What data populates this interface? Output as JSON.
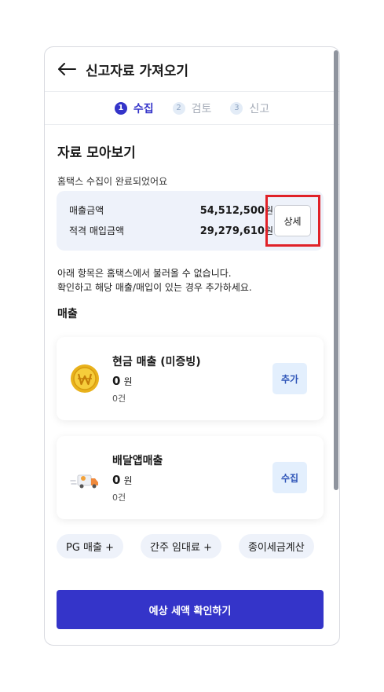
{
  "header": {
    "title": "신고자료 가져오기"
  },
  "stepper": {
    "steps": [
      {
        "num": "1",
        "label": "수집"
      },
      {
        "num": "2",
        "label": "검토"
      },
      {
        "num": "3",
        "label": "신고"
      }
    ]
  },
  "summary": {
    "section_title": "자료 모아보기",
    "status_text": "홈택스 수집이 완료되었어요",
    "rows": [
      {
        "label": "매출금액",
        "value": "54,512,500",
        "unit": "원"
      },
      {
        "label": "적격 매입금액",
        "value": "29,279,610",
        "unit": "원"
      }
    ],
    "detail_label": "상세"
  },
  "notice": {
    "line1": "아래 항목은 홈택스에서 불러올 수 없습니다.",
    "line2": "확인하고 해당 매출/매입이 있는 경우 추가하세요."
  },
  "sales": {
    "heading": "매출",
    "cards": [
      {
        "title": "현금 매출 (미증빙)",
        "amount": "0",
        "unit": "원",
        "count": "0건",
        "button": "추가",
        "icon": "coin-icon"
      },
      {
        "title": "배달앱매출",
        "amount": "0",
        "unit": "원",
        "count": "0건",
        "button": "수집",
        "icon": "delivery-truck-icon"
      }
    ]
  },
  "chips": [
    "PG 매출 +",
    "간주 임대료 +",
    "종이세금계산"
  ],
  "cta": {
    "label": "예상 세액 확인하기"
  },
  "colors": {
    "accent": "#3434c9",
    "highlight": "#e02128",
    "summary_bg": "#eef2fa"
  }
}
